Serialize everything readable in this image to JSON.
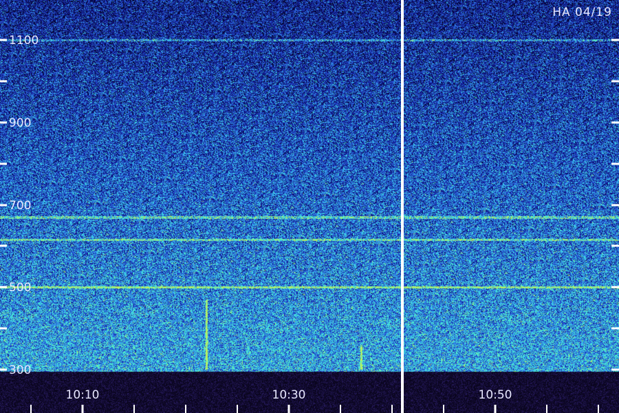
{
  "chart_data": {
    "type": "heatmap",
    "station_label": "HA 04/19",
    "y_axis": {
      "range": [
        300,
        1100
      ],
      "labeled_ticks": [
        300,
        500,
        700,
        900,
        1100
      ],
      "tick_labels": [
        "300",
        "500",
        "700",
        "900",
        "1100"
      ],
      "minor_ticks": [
        400,
        600,
        800,
        1000
      ],
      "tick_side": "both"
    },
    "x_axis": {
      "range_minutes": [
        "10:02",
        "11:02"
      ],
      "tick_labels": [
        "10:10",
        "10:30",
        "10:50"
      ],
      "major_tick_times": [
        "10:10",
        "10:30",
        "10:50"
      ],
      "minor_tick_interval_minutes": 5,
      "data_gap_at": "10:41"
    },
    "colormap": [
      "#05052a",
      "#0a0e6e",
      "#1a2fb0",
      "#2e6fe0",
      "#39c6ee",
      "#4ff0c8",
      "#b8f060"
    ],
    "features": [
      {
        "type": "horizontal-line",
        "frequency": 500,
        "intensity": 0.6
      },
      {
        "type": "horizontal-line",
        "frequency": 615,
        "intensity": 0.45
      },
      {
        "type": "horizontal-line",
        "frequency": 670,
        "intensity": 0.4
      },
      {
        "type": "horizontal-line",
        "frequency": 1100,
        "intensity": 0.35
      },
      {
        "type": "vertical-burst",
        "time": "10:22",
        "freq_range": [
          300,
          470
        ],
        "intensity": 0.7
      },
      {
        "type": "vertical-burst",
        "time": "10:37",
        "freq_range": [
          300,
          360
        ],
        "intensity": 0.6
      }
    ],
    "grid": false
  }
}
